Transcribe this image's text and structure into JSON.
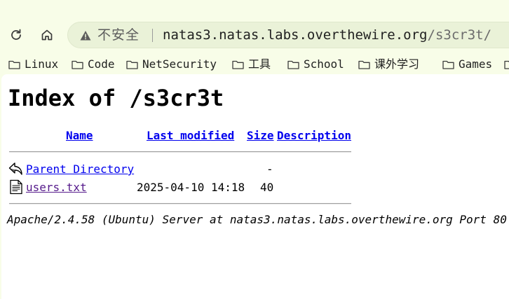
{
  "browser": {
    "security_label": "不安全",
    "url_host": "natas3.natas.labs.overthewire.org",
    "url_path": "/s3cr3t/"
  },
  "bookmarks": [
    {
      "label": "Linux"
    },
    {
      "label": "Code"
    },
    {
      "label": "NetSecurity"
    },
    {
      "label": "工具"
    },
    {
      "label": "School"
    },
    {
      "label": "课外学习"
    },
    {
      "label": "Games"
    }
  ],
  "page": {
    "title": "Index of /s3cr3t",
    "columns": {
      "name": "Name",
      "last_modified": "Last modified",
      "size": "Size",
      "description": "Description"
    },
    "rows": [
      {
        "name": "Parent Directory",
        "last_modified": "",
        "size": "-",
        "icon": "back-icon"
      },
      {
        "name": "users.txt",
        "last_modified": "2025-04-10 14:18",
        "size": "40",
        "icon": "text-file-icon"
      }
    ],
    "address": "Apache/2.4.58 (Ubuntu) Server at natas3.natas.labs.overthewire.org Port 80"
  }
}
